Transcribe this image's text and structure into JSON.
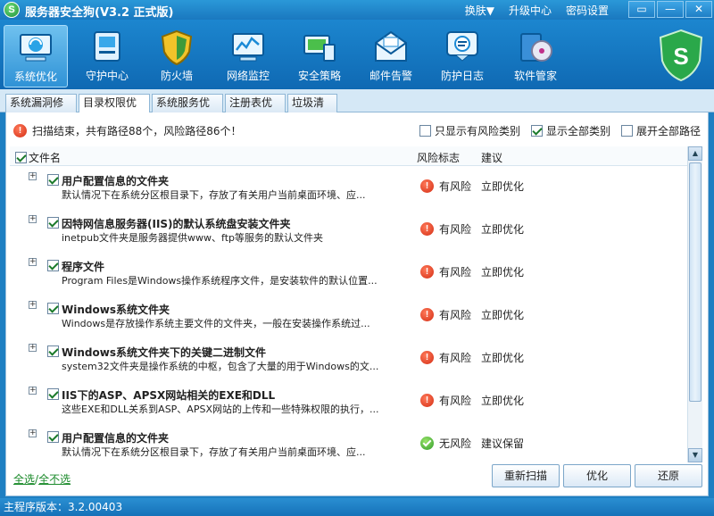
{
  "app": {
    "title": "服务器安全狗(V3.2 正式版)",
    "logo_letter": "S"
  },
  "top_links": [
    "换肤▼",
    "升级中心",
    "密码设置"
  ],
  "window_buttons": [
    "▭",
    "—",
    "✕"
  ],
  "toolbar": [
    {
      "label": "系统优化",
      "icon": "monitor-optimize-icon",
      "active": true
    },
    {
      "label": "守护中心",
      "icon": "guard-center-icon",
      "active": false
    },
    {
      "label": "防火墙",
      "icon": "firewall-shield-icon",
      "active": false
    },
    {
      "label": "网络监控",
      "icon": "network-monitor-icon",
      "active": false
    },
    {
      "label": "安全策略",
      "icon": "security-policy-icon",
      "active": false
    },
    {
      "label": "邮件告警",
      "icon": "mail-alert-icon",
      "active": false
    },
    {
      "label": "防护日志",
      "icon": "protection-log-icon",
      "active": false
    },
    {
      "label": "软件管家",
      "icon": "software-manager-icon",
      "active": false
    }
  ],
  "tabs": [
    {
      "label": "系统漏洞修复",
      "active": false
    },
    {
      "label": "目录权限优化",
      "active": true
    },
    {
      "label": "系统服务优化",
      "active": false
    },
    {
      "label": "注册表优化",
      "active": false
    },
    {
      "label": "垃圾清理",
      "active": false
    }
  ],
  "status": {
    "text": "扫描结束，共有路径88个，风险路径86个！"
  },
  "filters": [
    {
      "label": "只显示有风险类别",
      "checked": false
    },
    {
      "label": "显示全部类别",
      "checked": true
    },
    {
      "label": "展开全部路径",
      "checked": false
    }
  ],
  "columns": {
    "name": "文件名",
    "risk": "风险标志",
    "suggest": "建议"
  },
  "rows": [
    {
      "title": "用户配置信息的文件夹",
      "desc": "默认情况下在系统分区根目录下，存放了有关用户当前桌面环境、应...",
      "risk": "有风险",
      "risk_level": "risk",
      "suggest": "立即优化"
    },
    {
      "title": "因特网信息服务器(IIS)的默认系统盘安装文件夹",
      "desc": "inetpub文件夹是服务器提供www、ftp等服务的默认文件夹",
      "risk": "有风险",
      "risk_level": "risk",
      "suggest": "立即优化"
    },
    {
      "title": "程序文件",
      "desc": "Program Files是Windows操作系统程序文件，是安装软件的默认位置...",
      "risk": "有风险",
      "risk_level": "risk",
      "suggest": "立即优化"
    },
    {
      "title": "Windows系统文件夹",
      "desc": "Windows是存放操作系统主要文件的文件夹，一般在安装操作系统过...",
      "risk": "有风险",
      "risk_level": "risk",
      "suggest": "立即优化"
    },
    {
      "title": "Windows系统文件夹下的关键二进制文件",
      "desc": "system32文件夹是操作系统的中枢，包含了大量的用于Windows的文...",
      "risk": "有风险",
      "risk_level": "risk",
      "suggest": "立即优化"
    },
    {
      "title": "IIS下的ASP、APSX网站相关的EXE和DLL",
      "desc": "这些EXE和DLL关系到ASP、APSX网站的上传和一些特殊权限的执行，...",
      "risk": "有风险",
      "risk_level": "risk",
      "suggest": "立即优化"
    },
    {
      "title": "用户配置信息的文件夹",
      "desc": "默认情况下在系统分区根目录下，存放了有关用户当前桌面环境、应...",
      "risk": "无风险",
      "risk_level": "safe",
      "suggest": "建议保留"
    }
  ],
  "footer": {
    "select_all": "全选",
    "separator": "/",
    "select_none": "全不选",
    "rescan": "重新扫描",
    "optimize": "优化",
    "restore": "还原"
  },
  "statusbar": {
    "version": "主程序版本：3.2.00403"
  },
  "colors": {
    "brand_blue": "#1a78bf",
    "risk_red": "#d42d14",
    "safe_green": "#2f9a2a"
  }
}
